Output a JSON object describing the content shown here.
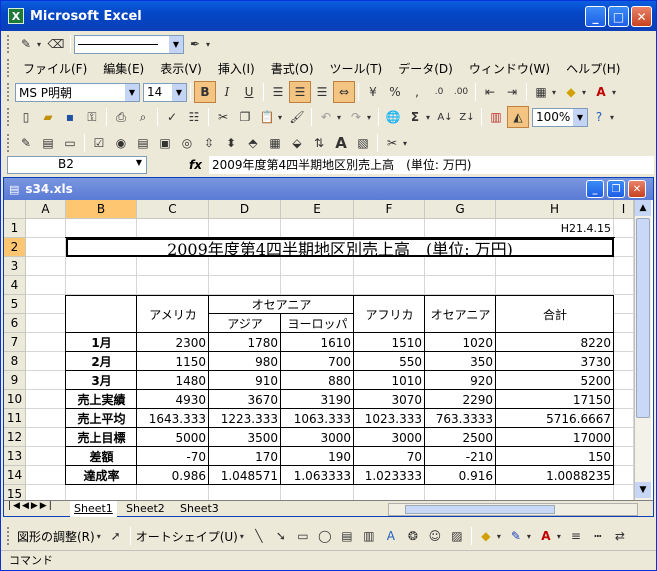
{
  "window": {
    "title": "Microsoft Excel",
    "icon": "X"
  },
  "menu": [
    "ファイル(F)",
    "編集(E)",
    "表示(V)",
    "挿入(I)",
    "書式(O)",
    "ツール(T)",
    "データ(D)",
    "ウィンドウ(W)",
    "ヘルプ(H)"
  ],
  "font": {
    "name": "MS P明朝",
    "size": "14"
  },
  "toolbar": {
    "zoom": "100%",
    "sigma": "Σ",
    "text_a": "A",
    "percent": "%",
    "comma": ","
  },
  "namebox": "B2",
  "fx": "fx",
  "formula": "2009年度第4四半期地区別売上高　(単位: 万円)",
  "workbook": {
    "title": "s34.xls"
  },
  "columns": [
    "A",
    "B",
    "C",
    "D",
    "E",
    "F",
    "G",
    "H",
    "I"
  ],
  "rows": [
    "1",
    "2",
    "3",
    "4",
    "5",
    "6",
    "7",
    "8",
    "9",
    "10",
    "11",
    "12",
    "13",
    "14",
    "15"
  ],
  "sheet": {
    "date": "H21.4.15",
    "title": "2009年度第4四半期地区別売上高　(単位: 万円)",
    "headers": {
      "america": "アメリカ",
      "oceania_group": "オセアニア",
      "asia": "アジア",
      "europe": "ヨーロッパ",
      "africa": "アフリカ",
      "oceania": "オセアニア",
      "total": "合計"
    },
    "table": [
      {
        "label": "1月",
        "values": [
          "2300",
          "1780",
          "1610",
          "1510",
          "1020",
          "8220"
        ]
      },
      {
        "label": "2月",
        "values": [
          "1150",
          "980",
          "700",
          "550",
          "350",
          "3730"
        ]
      },
      {
        "label": "3月",
        "values": [
          "1480",
          "910",
          "880",
          "1010",
          "920",
          "5200"
        ]
      },
      {
        "label": "売上実績",
        "values": [
          "4930",
          "3670",
          "3190",
          "3070",
          "2290",
          "17150"
        ]
      },
      {
        "label": "売上平均",
        "values": [
          "1643.333",
          "1223.333",
          "1063.333",
          "1023.333",
          "763.3333",
          "5716.6667"
        ]
      },
      {
        "label": "売上目標",
        "values": [
          "5000",
          "3500",
          "3000",
          "3000",
          "2500",
          "17000"
        ]
      },
      {
        "label": "差額",
        "values": [
          "-70",
          "170",
          "190",
          "70",
          "-210",
          "150"
        ]
      },
      {
        "label": "達成率",
        "values": [
          "0.986",
          "1.048571",
          "1.063333",
          "1.023333",
          "0.916",
          "1.0088235"
        ]
      }
    ]
  },
  "tabs": [
    "Sheet1",
    "Sheet2",
    "Sheet3"
  ],
  "drawing": {
    "adjust": "図形の調整(R)",
    "autoshape": "オートシェイプ(U)"
  },
  "status": "コマンド"
}
